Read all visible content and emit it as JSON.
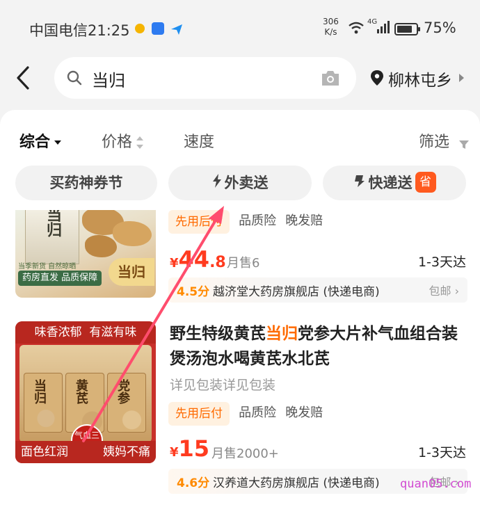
{
  "status_bar": {
    "carrier_time": "中国电信21:25",
    "speed_value": "306",
    "speed_unit": "K/s",
    "network": "4G",
    "battery": "75%"
  },
  "search": {
    "query": "当归",
    "location": "柳林屯乡"
  },
  "sort_tabs": [
    "综合",
    "价格",
    "速度"
  ],
  "filter_label": "筛选",
  "chips": {
    "promo": "买药神券节",
    "takeout": "外卖送",
    "express": "快递送",
    "express_badge": "省"
  },
  "products": [
    {
      "image_texts": {
        "box_label": "当归",
        "top_tag": "当季新货 自然晾晒",
        "bottom_tag": "药房直发 品质保障",
        "badge": "当归"
      },
      "tag_pay": "先用后付",
      "tag_insurance": "品质险",
      "tag_late": "晚发赔",
      "price_symbol": "¥",
      "price_int": "44",
      "price_dec": ".8",
      "sold": "月售6",
      "eta": "1-3天达",
      "shop_score": "4.5分",
      "shop_name": "越济堂大药房旗舰店 (快递电商)",
      "shipping": "包邮 ›"
    },
    {
      "image_texts": {
        "top_strip_left": "味香浓郁",
        "top_strip_right": "有滋有味",
        "bag1": "当归",
        "bag2": "黄芪",
        "bag3": "党参",
        "seal": "气血三宝",
        "bottom_left": "面色红润",
        "bottom_right": "姨妈不痛"
      },
      "title_pre": "野生特级黄芪",
      "title_highlight": "当归",
      "title_post": "党参大片补气血组合装煲汤泡水喝黄芪水北芪",
      "spec": "详见包装详见包装",
      "tag_pay": "先用后付",
      "tag_insurance": "品质险",
      "tag_late": "晚发赔",
      "price_symbol": "¥",
      "price_int": "15",
      "sold": "月售2000+",
      "eta": "1-3天达",
      "shop_score": "4.6分",
      "shop_name": "汉养道大药房旗舰店 (快递电商)",
      "shipping": "包邮 ›"
    }
  ],
  "watermark": "quan05.com",
  "colors": {
    "accent": "#ff3b1f",
    "highlight": "#ff6a00",
    "arrow": "#ff4d6d"
  }
}
